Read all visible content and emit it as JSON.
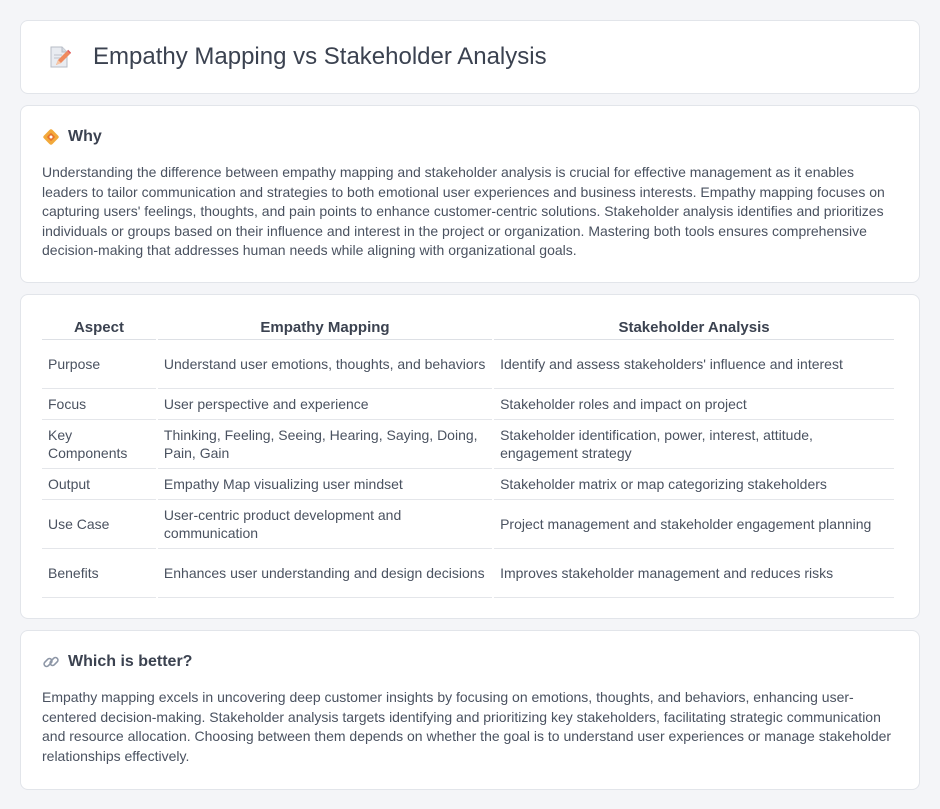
{
  "header": {
    "title": "Empathy Mapping vs Stakeholder Analysis",
    "icon": "document-pencil-icon"
  },
  "why": {
    "title": "Why",
    "icon": "diamond-sign-icon",
    "text": "Understanding the difference between empathy mapping and stakeholder analysis is crucial for effective management as it enables leaders to tailor communication and strategies to both emotional user experiences and business interests. Empathy mapping focuses on capturing users' feelings, thoughts, and pain points to enhance customer-centric solutions. Stakeholder analysis identifies and prioritizes individuals or groups based on their influence and interest in the project or organization. Mastering both tools ensures comprehensive decision-making that addresses human needs while aligning with organizational goals."
  },
  "table": {
    "headers": [
      "Aspect",
      "Empathy Mapping",
      "Stakeholder Analysis"
    ],
    "rows": [
      [
        "Purpose",
        "Understand user emotions, thoughts, and behaviors",
        "Identify and assess stakeholders' influence and interest"
      ],
      [
        "Focus",
        "User perspective and experience",
        "Stakeholder roles and impact on project"
      ],
      [
        "Key Components",
        "Thinking, Feeling, Seeing, Hearing, Saying, Doing, Pain, Gain",
        "Stakeholder identification, power, interest, attitude, engagement strategy"
      ],
      [
        "Output",
        "Empathy Map visualizing user mindset",
        "Stakeholder matrix or map categorizing stakeholders"
      ],
      [
        "Use Case",
        "User-centric product development and communication",
        "Project management and stakeholder engagement planning"
      ],
      [
        "Benefits",
        "Enhances user understanding and design decisions",
        "Improves stakeholder management and reduces risks"
      ]
    ]
  },
  "better": {
    "title": "Which is better?",
    "icon": "link-icon",
    "text": "Empathy mapping excels in uncovering deep customer insights by focusing on emotions, thoughts, and behaviors, enhancing user-centered decision-making. Stakeholder analysis targets identifying and prioritizing key stakeholders, facilitating strategic communication and resource allocation. Choosing between them depends on whether the goal is to understand user experiences or manage stakeholder relationships effectively."
  }
}
